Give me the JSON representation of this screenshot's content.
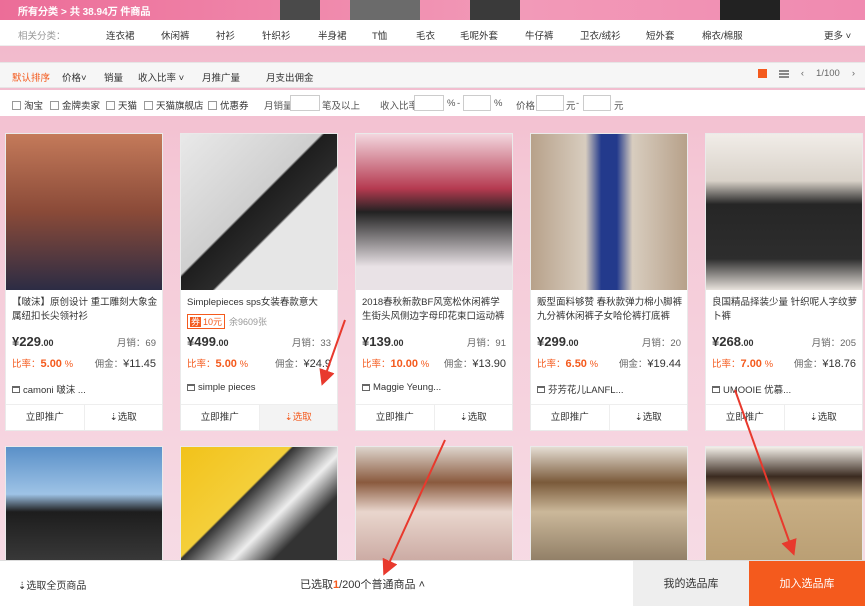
{
  "header": {
    "all_categories": "所有分类",
    "separator": ">",
    "total": "共 38.94万 件商品"
  },
  "categories": {
    "label": "相关分类：",
    "items": [
      "连衣裙",
      "休闲裤",
      "衬衫",
      "针织衫",
      "半身裙",
      "T恤",
      "毛衣",
      "毛呢外套",
      "牛仔裤",
      "卫衣/绒衫",
      "短外套",
      "棉衣/棉服"
    ],
    "more": "更多"
  },
  "sort": {
    "default": "默认排序",
    "price": "价格",
    "sales": "销量",
    "income_ratio": "收入比率",
    "monthly_promo": "月推广量",
    "monthly_commission": "月支出佣金",
    "page": "1/100"
  },
  "filters": {
    "taobao": "淘宝",
    "gold_seller": "金牌卖家",
    "tmall": "天猫",
    "tmall_flagship": "天猫旗舰店",
    "coupon": "优惠券",
    "monthly_sales": "月销量",
    "monthly_sales_suffix": "笔及以上",
    "income_ratio": "收入比率",
    "percent": "%",
    "dash": "-",
    "price": "价格",
    "yuan": "元"
  },
  "products": [
    {
      "title": "【啵沫】原创设计 重工雕刻大象金属纽扣长尖领衬衫",
      "price_int": "229",
      "price_dec": ".00",
      "sales": "月销：69",
      "ratio_label": "比率：",
      "ratio": "5.00",
      "ratio_unit": "%",
      "comm_label": "佣金：",
      "comm": "¥11.45",
      "shop": "camoni 啵沫 ...",
      "promote": "立即推广",
      "select": "选取"
    },
    {
      "title": "Simplepieces sps女装春款意大利...",
      "coupon_tag": "券",
      "coupon_val": "10元",
      "coupon_left": "余9609张",
      "price_int": "499",
      "price_dec": ".00",
      "sales": "月销：33",
      "ratio_label": "比率：",
      "ratio": "5.00",
      "ratio_unit": "%",
      "comm_label": "佣金：",
      "comm": "¥24.9",
      "shop": "simple pieces",
      "promote": "立即推广",
      "select": "选取"
    },
    {
      "title": "2018春秋新款BF风宽松休闲裤学生街头风侧边字母印花束口运动裤",
      "price_int": "139",
      "price_dec": ".00",
      "sales": "月销：91",
      "ratio_label": "比率：",
      "ratio": "10.00",
      "ratio_unit": "%",
      "comm_label": "佣金：",
      "comm": "¥13.90",
      "shop": "Maggie Yeung...",
      "promote": "立即推广",
      "select": "选取"
    },
    {
      "title": "贩型面料够赞 春秋款弹力棉小脚裤九分裤休闲裤子女哈伦裤打底裤",
      "price_int": "299",
      "price_dec": ".00",
      "sales": "月销：20",
      "ratio_label": "比率：",
      "ratio": "6.50",
      "ratio_unit": "%",
      "comm_label": "佣金：",
      "comm": "¥19.44",
      "shop": "芬芳花儿LANFL...",
      "promote": "立即推广",
      "select": "选取"
    },
    {
      "title": "良国精品择装少量 针织呢人字纹萝卜裤",
      "price_int": "268",
      "price_dec": ".00",
      "sales": "月销：205",
      "ratio_label": "比率：",
      "ratio": "7.00",
      "ratio_unit": "%",
      "comm_label": "佣金：",
      "comm": "¥18.76",
      "shop": "UMOOIE 优慕...",
      "promote": "立即推广",
      "select": "选取"
    }
  ],
  "bottom": {
    "select_all": "选取全页商品",
    "selected_prefix": "已选取",
    "selected_count": "1",
    "selected_suffix": "/200个普通商品",
    "my_library": "我的选品库",
    "add_library": "加入选品库"
  },
  "colors": {
    "accent": "#f45a1d",
    "annotation_arrow": "#e8392d"
  }
}
